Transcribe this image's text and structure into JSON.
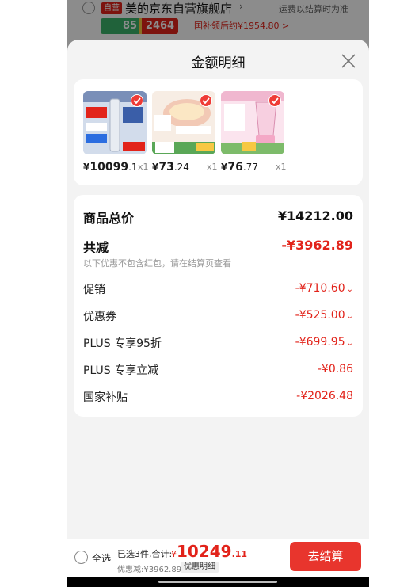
{
  "background_store": {
    "badge": "自营",
    "store_name": "美的京东自营旗舰店",
    "shipping_note": "运费以结算时为准",
    "promo_price": "2464",
    "promo_pct": "85",
    "subsidy_text": "国补领后约¥1954.80 >"
  },
  "sheet": {
    "title": "金额明细"
  },
  "products": [
    {
      "price_int": "10099",
      "price_dec": ".1",
      "qty": "x1",
      "colors": [
        "#7a8fb8",
        "#d2dceb"
      ]
    },
    {
      "price_int": "73",
      "price_dec": ".24",
      "qty": "x1",
      "colors": [
        "#f2c9b5",
        "#5aa757"
      ]
    },
    {
      "price_int": "76",
      "price_dec": ".77",
      "qty": "x1",
      "colors": [
        "#f7cfe0",
        "#7dbb6a"
      ]
    }
  ],
  "summary": {
    "total_label": "商品总价",
    "total_value": "¥14212.00",
    "discount_label": "共减",
    "discount_value": "-¥3962.89",
    "discount_note": "以下优惠不包含红包，请在结算页查看",
    "items": [
      {
        "label": "促销",
        "value": "-¥710.60",
        "expandable": true
      },
      {
        "label": "优惠券",
        "value": "-¥525.00",
        "expandable": true
      },
      {
        "label": "PLUS 专享95折",
        "value": "-¥699.95",
        "expandable": true
      },
      {
        "label": "PLUS 专享立减",
        "value": "-¥0.86",
        "expandable": false
      },
      {
        "label": "国家补贴",
        "value": "-¥2026.48",
        "expandable": false
      }
    ]
  },
  "bottom_bar": {
    "select_all": "全选",
    "selected_text": "已选3件,合计:",
    "total_yen": "¥",
    "total_int": "10249",
    "total_dec": ".11",
    "discount_text": "优惠减:¥3962.89",
    "detail_chip": "优惠明细",
    "checkout": "去结算"
  },
  "colors": {
    "accent_red": "#e2231a",
    "checkout_red": "#e8352d"
  }
}
